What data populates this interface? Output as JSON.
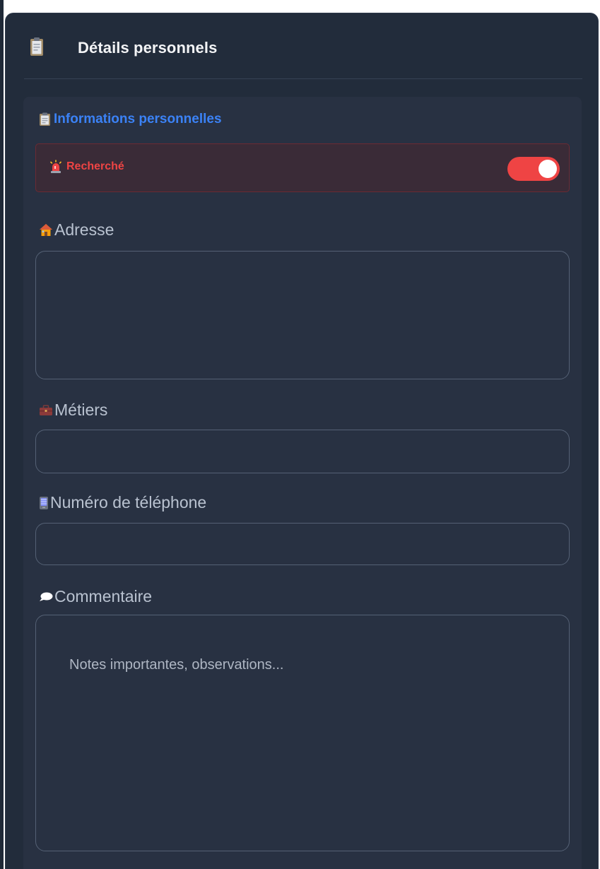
{
  "panel": {
    "title": "Détails personnels",
    "header_icon": "clipboard-icon"
  },
  "section": {
    "title": "Informations personnelles",
    "icon": "clipboard-icon",
    "accent_color": "#3b82f6"
  },
  "wanted": {
    "label": "Recherché",
    "icon": "siren-icon",
    "toggle_on": true,
    "color": "#ef4444"
  },
  "fields": {
    "address": {
      "label": "Adresse",
      "icon": "house-icon",
      "value": ""
    },
    "jobs": {
      "label": "Métiers",
      "icon": "briefcase-icon",
      "value": ""
    },
    "phone": {
      "label": "Numéro de téléphone",
      "icon": "phone-icon",
      "value": ""
    },
    "comment": {
      "label": "Commentaire",
      "icon": "speech-bubble-icon",
      "value": "",
      "placeholder": "Notes importantes, observations..."
    }
  }
}
